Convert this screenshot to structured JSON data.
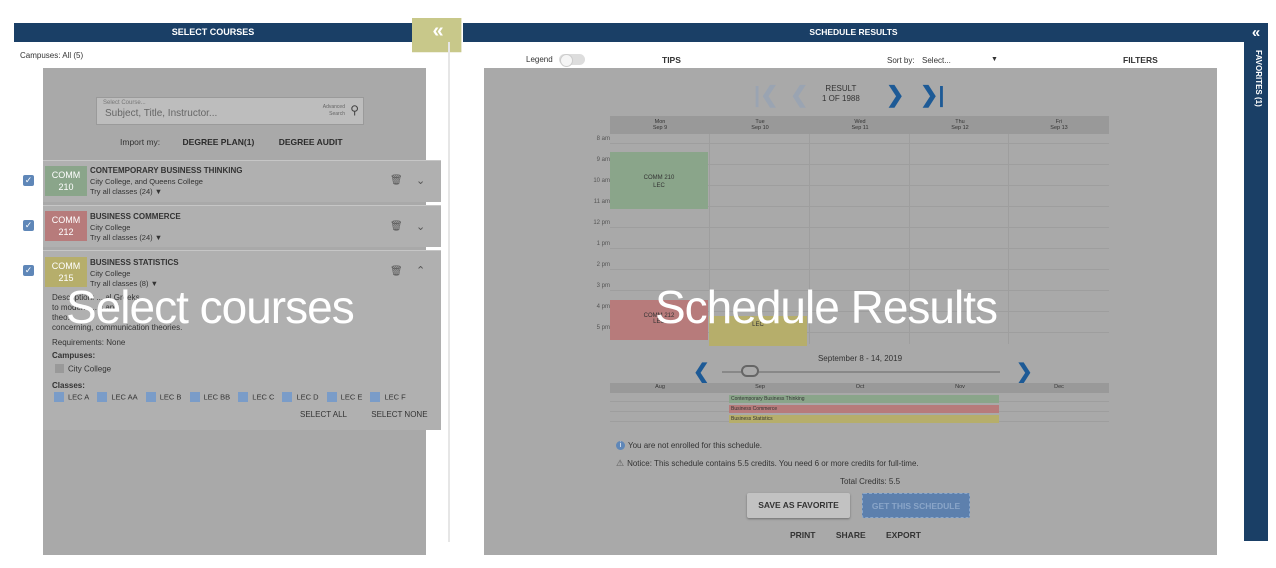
{
  "left_panel": {
    "header": "SELECT COURSES",
    "collapse_glyph": "«",
    "campuses_label": "Campuses: All (5)",
    "search": {
      "label": "Select Course...",
      "placeholder": "Subject, Title, Instructor...",
      "advanced": "Advanced Search"
    },
    "import_label": "Import my:",
    "import_degree_plan": "DEGREE PLAN(1)",
    "import_degree_audit": "DEGREE AUDIT",
    "courses": [
      {
        "subject": "COMM",
        "number": "210",
        "title": "CONTEMPORARY BUSINESS THINKING",
        "campus": "City College, and Queens College",
        "try": "Try all classes (24) ▼",
        "color": "#8aa58a"
      },
      {
        "subject": "COMM",
        "number": "212",
        "title": "BUSINESS COMMERCE",
        "campus": "City College",
        "try": "Try all classes (24) ▼",
        "color": "#b77b7b"
      },
      {
        "subject": "COMM",
        "number": "215",
        "title": "BUSINESS STATISTICS",
        "campus": "City College",
        "try": "Try all classes (8) ▼",
        "color": "#b6ae6b"
      }
    ],
    "description_1": "Description: ... al Greeks",
    "description_2": "to modern ... s and",
    "description_3": "theo... ",
    "description_4": "concerning, communication theories.",
    "requirements": "Requirements: None",
    "campuses_heading": "Campuses:",
    "campus_item": "City College",
    "classes_heading": "Classes:",
    "classes": [
      "LEC A",
      "LEC AA",
      "LEC B",
      "LEC BB",
      "LEC C",
      "LEC D",
      "LEC E",
      "LEC F"
    ],
    "select_all": "SELECT ALL",
    "select_none": "SELECT NONE",
    "overlay_text": "Select courses"
  },
  "right_panel": {
    "header": "SCHEDULE RESULTS",
    "legend_label": "Legend",
    "tips": "TIPS",
    "sort_label": "Sort by:",
    "sort_value": "Select...",
    "filters": "FILTERS",
    "result_line1": "RESULT",
    "result_line2": "1 OF 1988",
    "days": [
      {
        "name": "Mon",
        "date": "Sep 9"
      },
      {
        "name": "Tue",
        "date": "Sep 10"
      },
      {
        "name": "Wed",
        "date": "Sep 11"
      },
      {
        "name": "Thu",
        "date": "Sep 12"
      },
      {
        "name": "Fri",
        "date": "Sep 13"
      }
    ],
    "hours": [
      "8 am",
      "9 am",
      "10 am",
      "11 am",
      "12 pm",
      "1 pm",
      "2 pm",
      "3 pm",
      "4 pm",
      "5 pm"
    ],
    "block_210": "COMM 210\nLEC",
    "block_212": "COMM 212\nLEC",
    "block_215": "LEC",
    "week_label": "September 8 - 14, 2019",
    "months": [
      "Aug",
      "Sep",
      "Oct",
      "Nov",
      "Dec"
    ],
    "timeline": [
      "Contemporary Business Thinking",
      "Business Commerce",
      "Business Statistics"
    ],
    "notice_enrolled": "You are not enrolled for this schedule.",
    "notice_credits": "Notice: This schedule contains 5.5 credits. You need 6 or more credits for full-time.",
    "total_credits": "Total Credits: 5.5",
    "save_button": "SAVE AS FAVORITE",
    "get_button": "GET THIS SCHEDULE",
    "print": "PRINT",
    "share": "SHARE",
    "export": "EXPORT",
    "overlay_text": "Schedule Results"
  },
  "favorites": {
    "label": "FAVORITES (1)",
    "arrow": "«"
  },
  "colors": {
    "header": "#1a3f66",
    "accent": "#1d5a96"
  }
}
